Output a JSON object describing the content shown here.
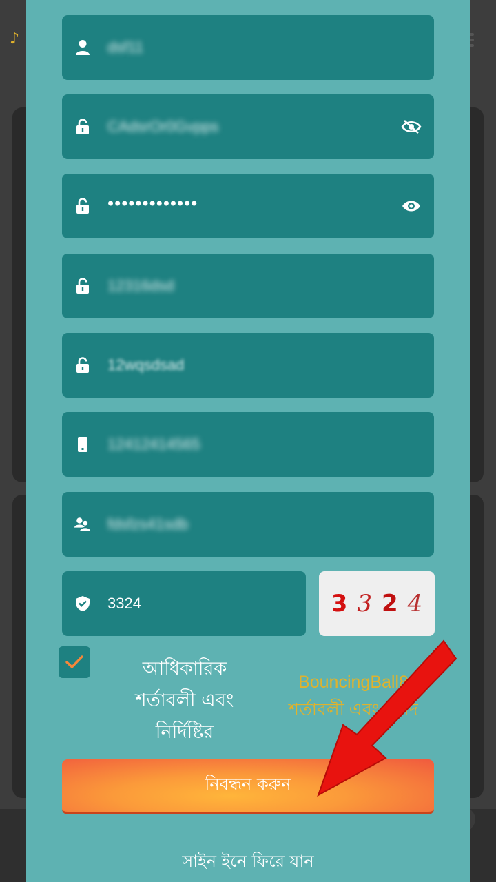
{
  "form": {
    "username": {
      "value": "dsf11",
      "icon": "user-icon"
    },
    "password": {
      "value": "CAdsrOr0Gvpps",
      "icon": "lock-icon",
      "toggle_icon": "eye-off-icon"
    },
    "confirm_password": {
      "value": "•••••••••••••",
      "icon": "lock-icon",
      "toggle_icon": "eye-icon"
    },
    "withdraw_password": {
      "value": "12316dsd",
      "icon": "lock-icon"
    },
    "confirm_withdraw_password": {
      "value": "12wqsdsad",
      "icon": "lock-icon"
    },
    "phone": {
      "value": "12412414565",
      "icon": "phone-icon"
    },
    "referral": {
      "value": "fdsfzs41sdb",
      "icon": "users-icon"
    },
    "captcha": {
      "value": "3324",
      "icon": "shield-icon",
      "image_digits": [
        "3",
        "3",
        "2",
        "4"
      ]
    }
  },
  "terms": {
    "checked": true,
    "official_text": [
      "আধিকারিক",
      "শর্তাবলী এবং",
      "নির্দিষ্টির"
    ],
    "brand_text": [
      "BouncingBall8",
      "শর্তাবলী এবং আদি"
    ]
  },
  "register_button": "নিবন্ধন করুন",
  "back_to_signin": "সাইন ইনে ফিরে যান",
  "colors": {
    "panel": "#5eb2b2",
    "field": "#1e8181",
    "accent_orange": "#f5873a",
    "brand_yellow": "#e0b22c",
    "arrow_red": "#e8130f"
  }
}
